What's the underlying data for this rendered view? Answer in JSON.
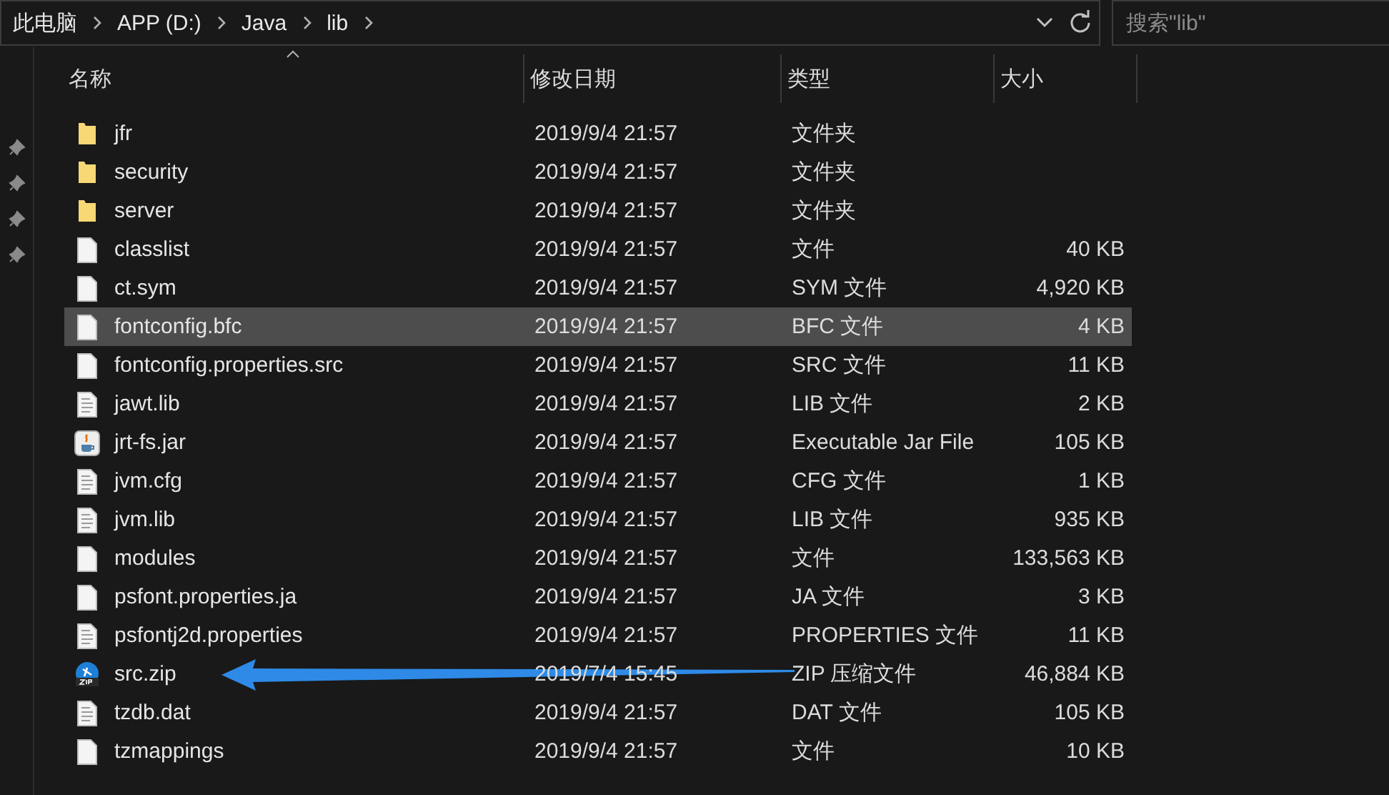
{
  "address_bar": {
    "crumbs": [
      "此电脑",
      "APP (D:)",
      "Java",
      "lib"
    ]
  },
  "search": {
    "placeholder": "搜索\"lib\""
  },
  "columns": [
    {
      "label": "名称",
      "sorted": true
    },
    {
      "label": "修改日期",
      "sorted": false
    },
    {
      "label": "类型",
      "sorted": false
    },
    {
      "label": "大小",
      "sorted": false
    }
  ],
  "rows": [
    {
      "name": "jfr",
      "kind": "folder",
      "modified": "2019/9/4 21:57",
      "type": "文件夹",
      "size": "",
      "selected": false
    },
    {
      "name": "security",
      "kind": "folder",
      "modified": "2019/9/4 21:57",
      "type": "文件夹",
      "selected": false
    },
    {
      "name": "server",
      "kind": "folder",
      "modified": "2019/9/4 21:57",
      "type": "文件夹",
      "selected": false
    },
    {
      "name": "classlist",
      "kind": "file",
      "modified": "2019/9/4 21:57",
      "type": "文件",
      "size": "40 KB",
      "selected": false
    },
    {
      "name": "ct.sym",
      "kind": "file",
      "modified": "2019/9/4 21:57",
      "type": "SYM 文件",
      "size": "4,920 KB",
      "selected": false
    },
    {
      "name": "fontconfig.bfc",
      "kind": "file",
      "modified": "2019/9/4 21:57",
      "type": "BFC 文件",
      "size": "4 KB",
      "selected": true
    },
    {
      "name": "fontconfig.properties.src",
      "kind": "file",
      "modified": "2019/9/4 21:57",
      "type": "SRC 文件",
      "size": "11 KB",
      "selected": false
    },
    {
      "name": "jawt.lib",
      "kind": "text",
      "modified": "2019/9/4 21:57",
      "type": "LIB 文件",
      "size": "2 KB",
      "selected": false
    },
    {
      "name": "jrt-fs.jar",
      "kind": "jar",
      "modified": "2019/9/4 21:57",
      "type": "Executable Jar File",
      "size": "105 KB",
      "selected": false
    },
    {
      "name": "jvm.cfg",
      "kind": "text",
      "modified": "2019/9/4 21:57",
      "type": "CFG 文件",
      "size": "1 KB",
      "selected": false
    },
    {
      "name": "jvm.lib",
      "kind": "text",
      "modified": "2019/9/4 21:57",
      "type": "LIB 文件",
      "size": "935 KB",
      "selected": false
    },
    {
      "name": "modules",
      "kind": "file",
      "modified": "2019/9/4 21:57",
      "type": "文件",
      "size": "133,563 KB",
      "selected": false
    },
    {
      "name": "psfont.properties.ja",
      "kind": "file",
      "modified": "2019/9/4 21:57",
      "type": "JA 文件",
      "size": "3 KB",
      "selected": false
    },
    {
      "name": "psfontj2d.properties",
      "kind": "text",
      "modified": "2019/9/4 21:57",
      "type": "PROPERTIES 文件",
      "size": "11 KB",
      "selected": false
    },
    {
      "name": "src.zip",
      "kind": "zip",
      "modified": "2019/7/4 15:45",
      "type": "ZIP 压缩文件",
      "size": "46,884 KB",
      "selected": false
    },
    {
      "name": "tzdb.dat",
      "kind": "text",
      "modified": "2019/9/4 21:57",
      "type": "DAT 文件",
      "size": "105 KB",
      "selected": false
    },
    {
      "name": "tzmappings",
      "kind": "file",
      "modified": "2019/9/4 21:57",
      "type": "文件",
      "size": "10 KB",
      "selected": false
    }
  ],
  "annotation": {
    "kind": "arrow"
  }
}
